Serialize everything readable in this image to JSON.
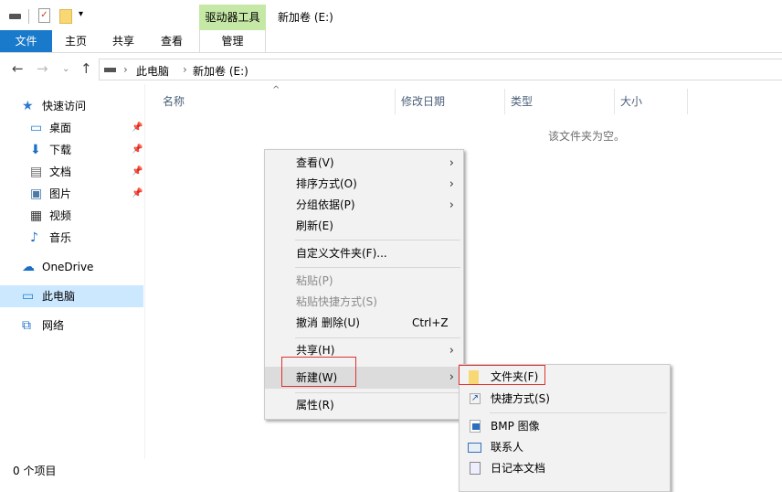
{
  "window": {
    "title": "新加卷 (E:)",
    "context_tab_group": "驱动器工具"
  },
  "ribbon": {
    "tabs": [
      "文件",
      "主页",
      "共享",
      "查看",
      "管理"
    ]
  },
  "address": {
    "segments": [
      "此电脑",
      "新加卷 (E:)"
    ]
  },
  "sidebar": {
    "items": [
      {
        "label": "快速访问",
        "icon": "star-icon"
      },
      {
        "label": "桌面",
        "icon": "desktop-icon",
        "pinned": true
      },
      {
        "label": "下载",
        "icon": "download-icon",
        "pinned": true
      },
      {
        "label": "文档",
        "icon": "document-icon",
        "pinned": true
      },
      {
        "label": "图片",
        "icon": "pictures-icon",
        "pinned": true
      },
      {
        "label": "视频",
        "icon": "video-icon"
      },
      {
        "label": "音乐",
        "icon": "music-icon"
      },
      {
        "label": "OneDrive",
        "icon": "cloud-icon"
      },
      {
        "label": "此电脑",
        "icon": "computer-icon",
        "selected": true
      },
      {
        "label": "网络",
        "icon": "network-icon"
      }
    ]
  },
  "columns": [
    "名称",
    "修改日期",
    "类型",
    "大小"
  ],
  "empty_text": "该文件夹为空。",
  "status": "0 个项目",
  "context_menu": {
    "items": [
      "查看(V)",
      "排序方式(O)",
      "分组依据(P)",
      "刷新(E)",
      "自定义文件夹(F)...",
      "粘贴(P)",
      "粘贴快捷方式(S)",
      "撤消 删除(U)",
      "共享(H)",
      "新建(W)",
      "属性(R)"
    ],
    "undo_shortcut": "Ctrl+Z"
  },
  "submenu": {
    "items": [
      "文件夹(F)",
      "快捷方式(S)",
      "BMP 图像",
      "联系人",
      "日记本文档"
    ]
  }
}
